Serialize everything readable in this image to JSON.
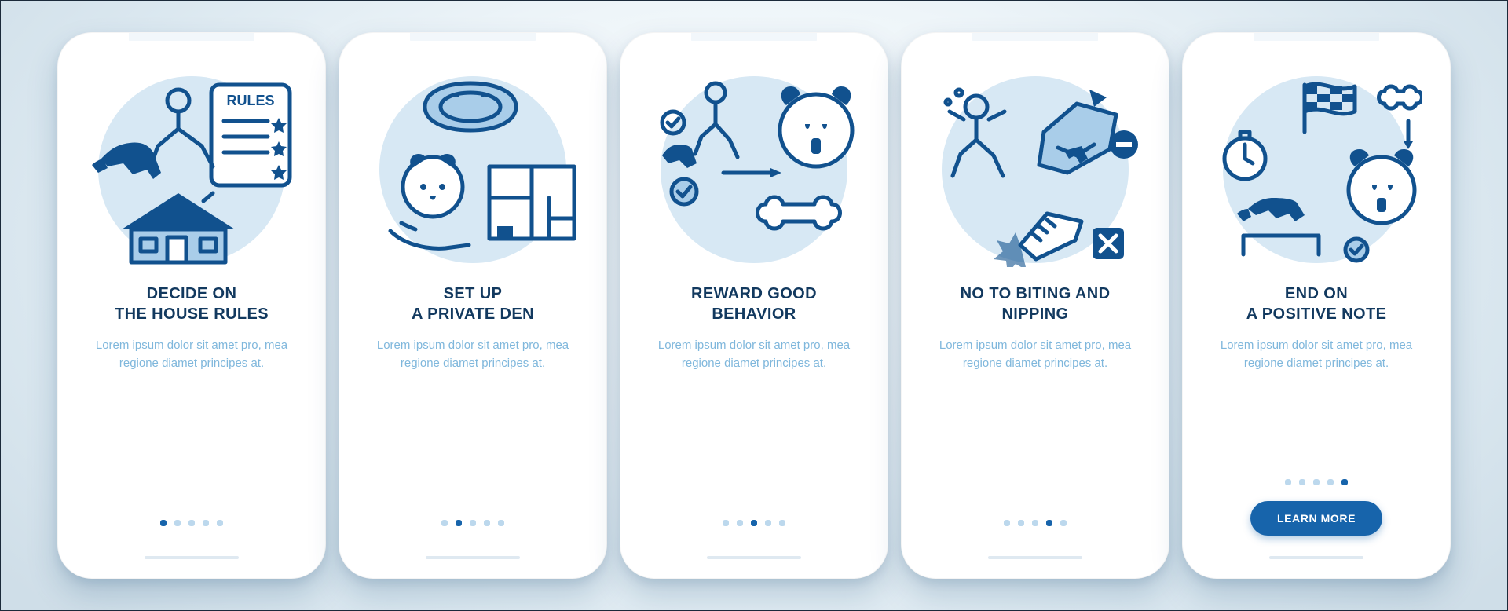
{
  "screens": [
    {
      "id": "rules",
      "title": "DECIDE ON\nTHE HOUSE RULES",
      "body": "Lorem ipsum dolor sit amet pro, mea regione diamet principes at.",
      "activeDot": 0
    },
    {
      "id": "den",
      "title": "SET UP\nA PRIVATE DEN",
      "body": "Lorem ipsum dolor sit amet pro, mea regione diamet principes at.",
      "activeDot": 1
    },
    {
      "id": "reward",
      "title": "REWARD GOOD\nBEHAVIOR",
      "body": "Lorem ipsum dolor sit amet pro, mea regione diamet principes at.",
      "activeDot": 2
    },
    {
      "id": "biting",
      "title": "NO TO BITING AND\nNIPPING",
      "body": "Lorem ipsum dolor sit amet pro, mea regione diamet principes at.",
      "activeDot": 3
    },
    {
      "id": "positive",
      "title": "END ON\nA POSITIVE NOTE",
      "body": "Lorem ipsum dolor sit amet pro, mea regione diamet principes at.",
      "activeDot": 4,
      "cta": "LEARN MORE"
    }
  ],
  "dotsCount": 5,
  "icons": {
    "rules": "house-rules-icon",
    "den": "private-den-icon",
    "reward": "reward-behavior-icon",
    "biting": "no-biting-icon",
    "positive": "positive-note-icon"
  },
  "colors": {
    "primary": "#1764ab",
    "text": "#12395f",
    "muted": "#7fb7dc",
    "circle": "#d7e8f4"
  },
  "cta_label": "LEARN MORE"
}
